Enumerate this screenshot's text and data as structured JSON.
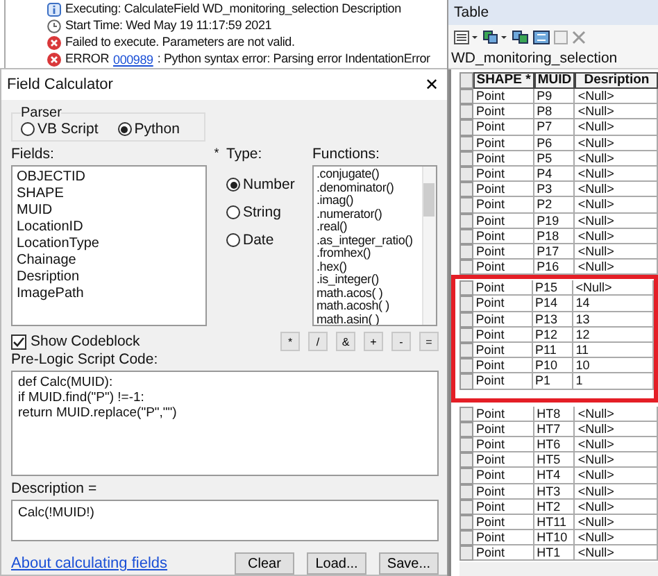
{
  "log": [
    {
      "kind": "info",
      "text": "Executing: CalculateField WD_monitoring_selection Description"
    },
    {
      "kind": "time",
      "text": "Start Time: Wed May 19 11:17:59 2021"
    },
    {
      "kind": "error",
      "text": "Failed to execute. Parameters are not valid."
    },
    {
      "kind": "error",
      "text": "ERROR ",
      "link": "000989",
      "rest": ": Python syntax error: Parsing error IndentationError"
    }
  ],
  "dialog": {
    "title": "Field Calculator",
    "close": "✕",
    "parser": {
      "label": "Parser",
      "options": [
        {
          "label": "VB Script",
          "selected": false
        },
        {
          "label": "Python",
          "selected": true
        }
      ]
    },
    "fields": {
      "label": "Fields:",
      "items": [
        "OBJECTID",
        "SHAPE",
        "MUID",
        "LocationID",
        "LocationType",
        "Chainage",
        "Desription",
        "ImagePath"
      ]
    },
    "type": {
      "label": "Type:",
      "options": [
        {
          "label": "Number",
          "selected": true
        },
        {
          "label": "String",
          "selected": false
        },
        {
          "label": "Date",
          "selected": false
        }
      ]
    },
    "functions": {
      "label": "Functions:",
      "items": [
        ".conjugate()",
        ".denominator()",
        ".imag()",
        ".numerator()",
        ".real()",
        ".as_integer_ratio()",
        ".fromhex()",
        ".hex()",
        ".is_integer()",
        "math.acos( )",
        "math.acosh( )",
        "math.asin( )"
      ]
    },
    "show_codeblock": {
      "label": "Show Codeblock",
      "checked": true
    },
    "operators": [
      "*",
      "/",
      "&",
      "+",
      "-",
      "="
    ],
    "prelogic": {
      "label": "Pre-Logic Script Code:",
      "lines": [
        "def Calc(MUID):",
        "if MUID.find(\"P\") !=-1:",
        "return MUID.replace(\"P\",\"\")"
      ]
    },
    "expression": {
      "label": "Description =",
      "value": "Calc(!MUID!)"
    },
    "help_link": "About calculating fields",
    "buttons": [
      "Clear",
      "Load...",
      "Save..."
    ]
  },
  "table": {
    "panel_title": "Table",
    "name": "WD_monitoring_selection",
    "columns": [
      "SHAPE *",
      "MUID",
      "Desription"
    ],
    "groups": [
      {
        "highlighted": false,
        "rows": [
          [
            "Point",
            "P9",
            "<Null>"
          ],
          [
            "Point",
            "P8",
            "<Null>"
          ],
          [
            "Point",
            "P7",
            "<Null>"
          ],
          [
            "Point",
            "P6",
            "<Null>"
          ],
          [
            "Point",
            "P5",
            "<Null>"
          ],
          [
            "Point",
            "P4",
            "<Null>"
          ],
          [
            "Point",
            "P3",
            "<Null>"
          ],
          [
            "Point",
            "P2",
            "<Null>"
          ],
          [
            "Point",
            "P19",
            "<Null>"
          ],
          [
            "Point",
            "P18",
            "<Null>"
          ],
          [
            "Point",
            "P17",
            "<Null>"
          ],
          [
            "Point",
            "P16",
            "<Null>"
          ]
        ]
      },
      {
        "highlighted": true,
        "rows": [
          [
            "Point",
            "P15",
            "<Null>"
          ],
          [
            "Point",
            "P14",
            "14"
          ],
          [
            "Point",
            "P13",
            "13"
          ],
          [
            "Point",
            "P12",
            "12"
          ],
          [
            "Point",
            "P11",
            "11"
          ],
          [
            "Point",
            "P10",
            "10"
          ],
          [
            "Point",
            "P1",
            "1"
          ]
        ]
      },
      {
        "highlighted": false,
        "rows": [
          [
            "Point",
            "HT8",
            "<Null>"
          ],
          [
            "Point",
            "HT7",
            "<Null>"
          ],
          [
            "Point",
            "HT6",
            "<Null>"
          ],
          [
            "Point",
            "HT5",
            "<Null>"
          ],
          [
            "Point",
            "HT4",
            "<Null>"
          ],
          [
            "Point",
            "HT3",
            "<Null>"
          ],
          [
            "Point",
            "HT2",
            "<Null>"
          ],
          [
            "Point",
            "HT11",
            "<Null>"
          ],
          [
            "Point",
            "HT10",
            "<Null>"
          ],
          [
            "Point",
            "HT1",
            "<Null>"
          ]
        ]
      }
    ]
  }
}
